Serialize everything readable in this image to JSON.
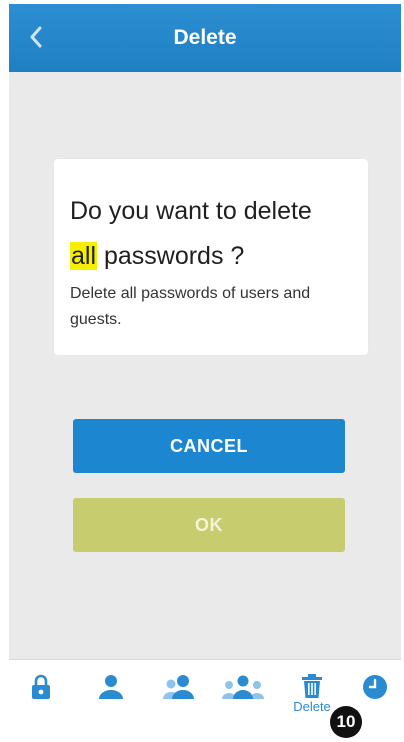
{
  "header": {
    "title": "Delete",
    "back_icon": "chevron-left-icon"
  },
  "dialog": {
    "question_prefix": "Do you want to delete",
    "question_highlight": "all",
    "question_suffix": "passwords ?",
    "description": "Delete all passwords of users and guests."
  },
  "buttons": {
    "cancel_label": "CANCEL",
    "ok_label": "OK"
  },
  "tabbar": {
    "items": [
      {
        "icon": "lock-icon",
        "label": ""
      },
      {
        "icon": "user-icon",
        "label": ""
      },
      {
        "icon": "two-users-icon",
        "label": ""
      },
      {
        "icon": "three-users-icon",
        "label": ""
      },
      {
        "icon": "trash-icon",
        "label": "Delete"
      },
      {
        "icon": "clock-icon",
        "label": ""
      }
    ]
  },
  "callout_badge": "10",
  "colors": {
    "header": "#1f7fc3",
    "cancel": "#1c86d0",
    "ok": "#c7cc6f",
    "highlight": "#f6f000",
    "icon": "#2a8bd0"
  }
}
